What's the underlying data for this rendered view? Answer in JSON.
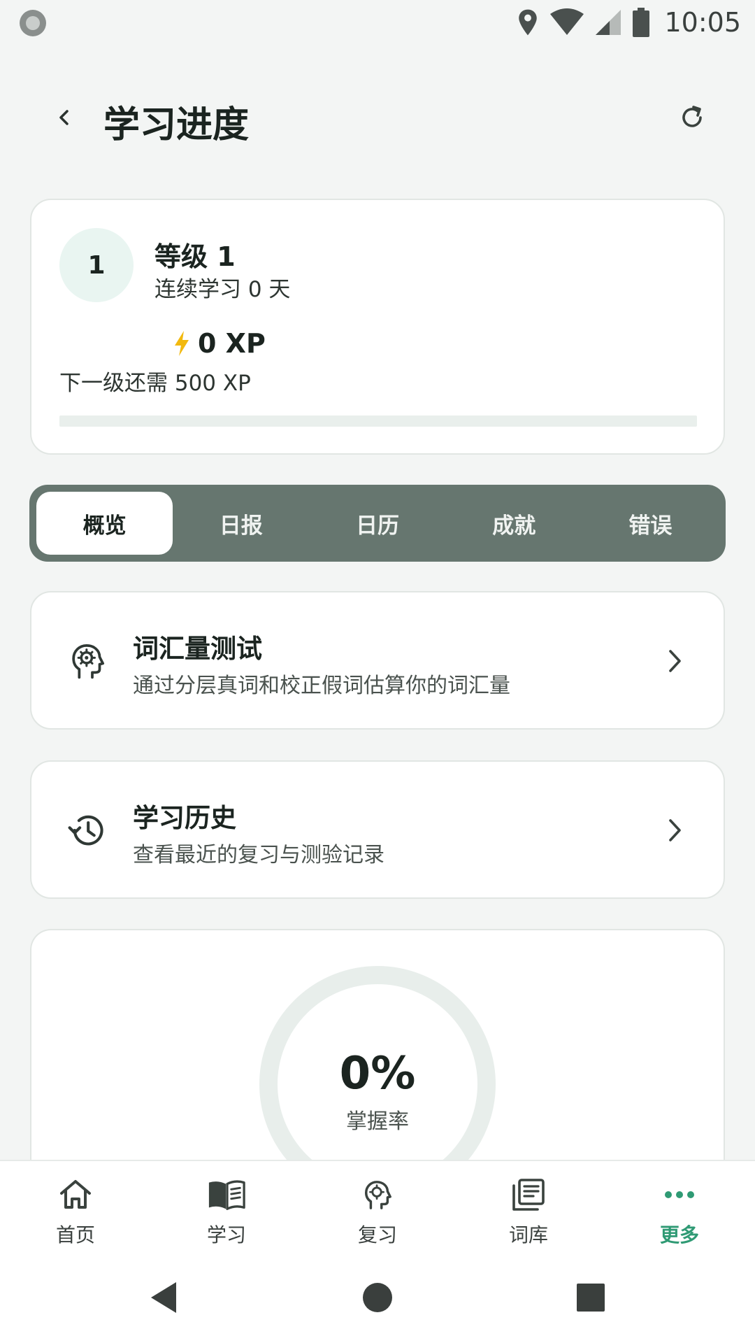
{
  "status_bar": {
    "time": "10:05"
  },
  "header": {
    "title": "学习进度"
  },
  "level_card": {
    "badge": "1",
    "level_name": "等级 1",
    "streak": "连续学习 0 天",
    "xp": "0 XP",
    "next_level": "下一级还需 500 XP",
    "progress": 0
  },
  "tabs": [
    {
      "label": "概览",
      "active": true
    },
    {
      "label": "日报",
      "active": false
    },
    {
      "label": "日历",
      "active": false
    },
    {
      "label": "成就",
      "active": false
    },
    {
      "label": "错误",
      "active": false
    }
  ],
  "cards": {
    "vocab": {
      "title": "词汇量测试",
      "subtitle": "通过分层真词和校正假词估算你的词汇量",
      "icon": "brain-gear-icon"
    },
    "history": {
      "title": "学习历史",
      "subtitle": "查看最近的复习与测验记录",
      "icon": "history-icon"
    }
  },
  "mastery": {
    "value": "0%",
    "label": "掌握率",
    "fraction": 0
  },
  "bottom_nav": [
    {
      "label": "首页",
      "icon": "home-icon",
      "active": false
    },
    {
      "label": "学习",
      "icon": "book-icon",
      "active": false
    },
    {
      "label": "复习",
      "icon": "brain-gear-icon",
      "active": false
    },
    {
      "label": "词库",
      "icon": "library-icon",
      "active": false
    },
    {
      "label": "更多",
      "icon": "more-dots-icon",
      "active": true
    }
  ],
  "colors": {
    "accent": "#2f9a74",
    "tab_bar": "#66766f",
    "xp_bolt": "#f2b90f",
    "ring_track": "#e8eeeb"
  }
}
